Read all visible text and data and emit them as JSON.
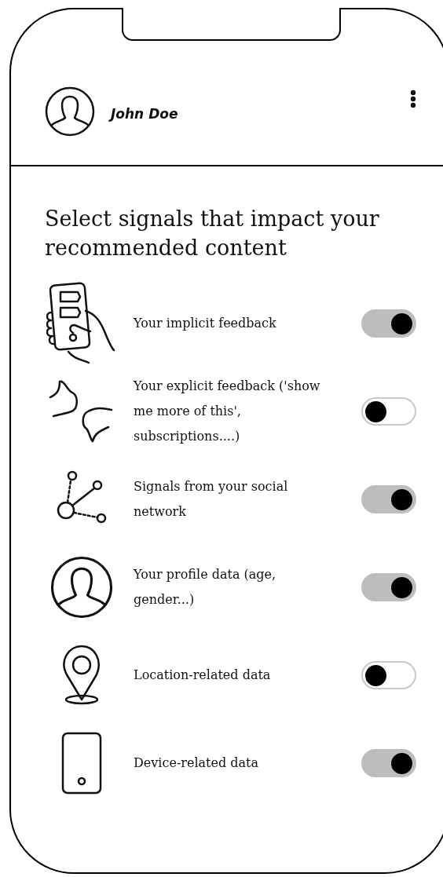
{
  "header": {
    "user_name": "John Doe"
  },
  "title": "Select signals that impact your recommended content",
  "signals": [
    {
      "kind": "hand-phone",
      "label": "Your implicit feedback",
      "on": true
    },
    {
      "kind": "thumbs",
      "label": "Your explicit feedback ('show me more of this', subscriptions....)",
      "on": false
    },
    {
      "kind": "network",
      "label": "Signals from your social network",
      "on": true
    },
    {
      "kind": "profile",
      "label": "Your profile data (age, gender...)",
      "on": true
    },
    {
      "kind": "location",
      "label": "Location-related data",
      "on": false
    },
    {
      "kind": "device",
      "label": "Device-related data",
      "on": true
    }
  ]
}
